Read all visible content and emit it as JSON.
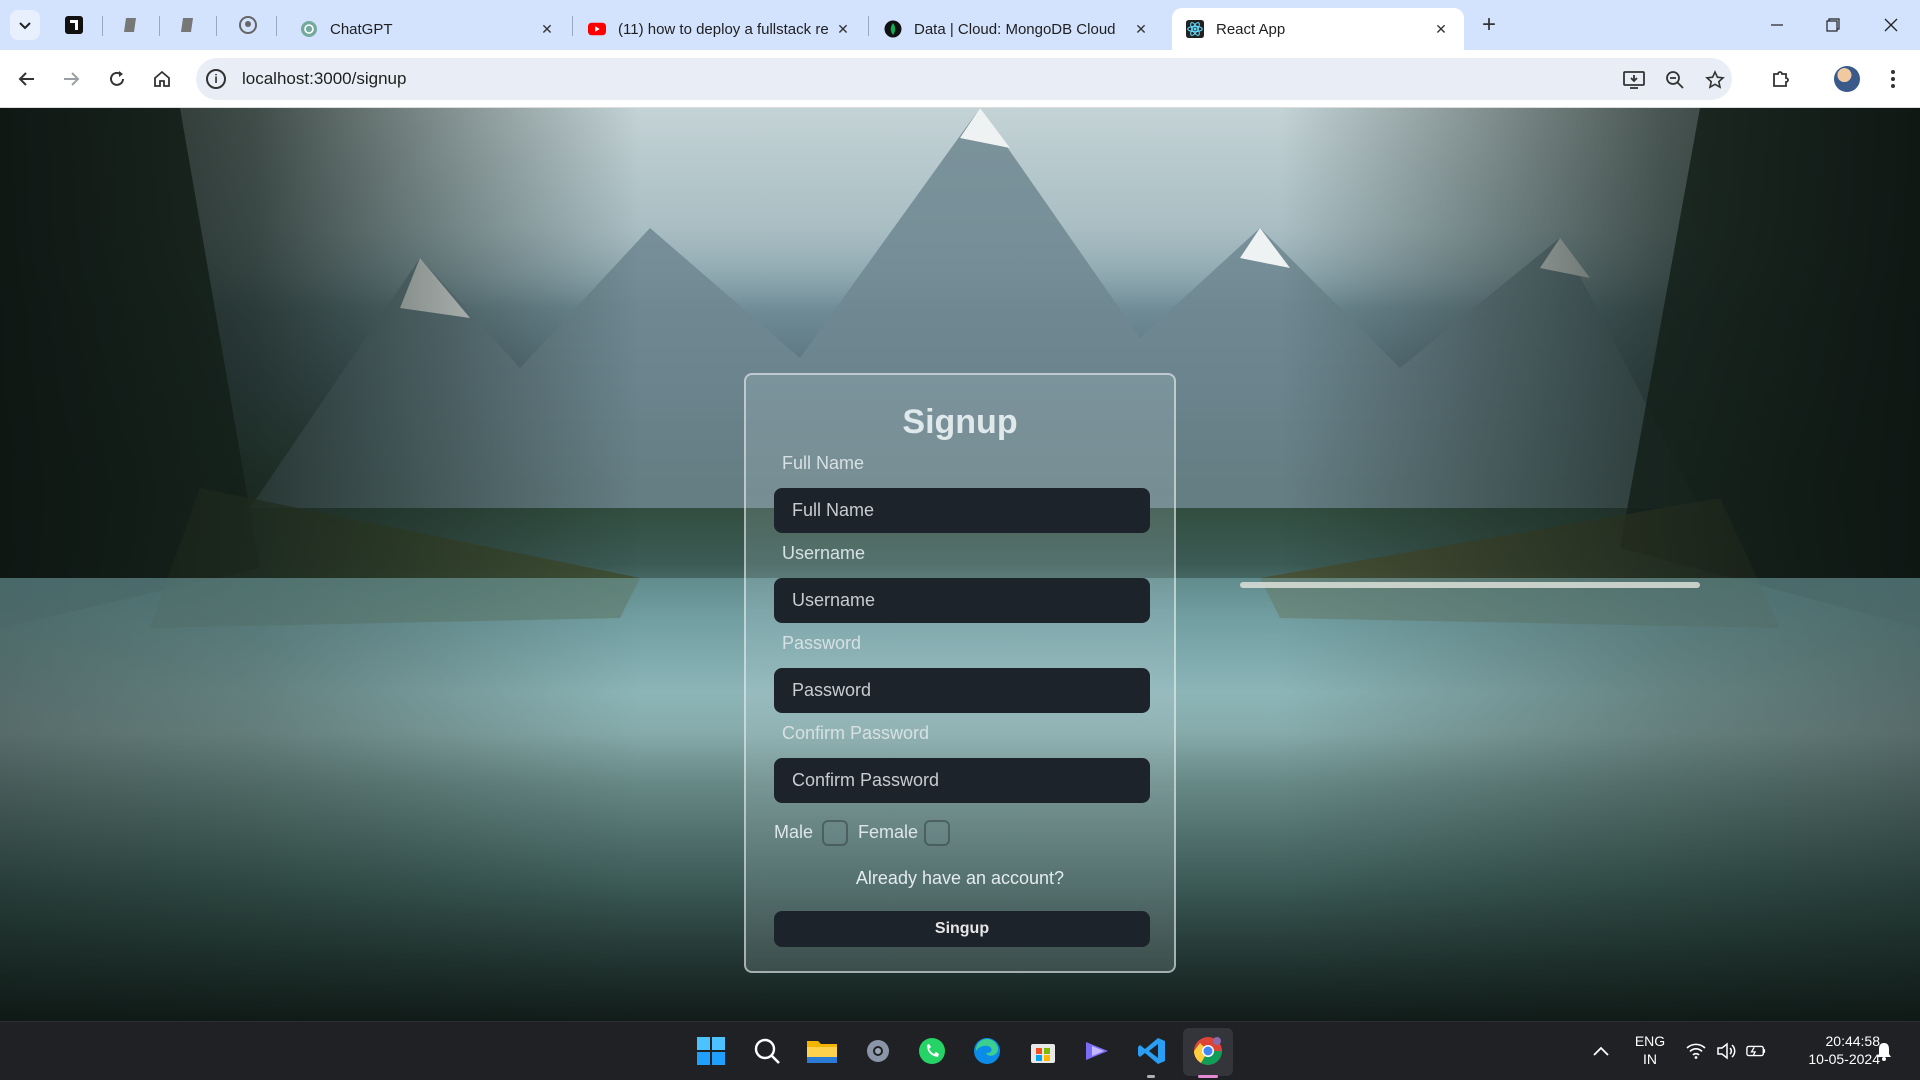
{
  "browser": {
    "tabs": [
      {
        "title": "ChatGPT",
        "icon": "chatgpt-icon"
      },
      {
        "title": "(11) how to deploy a fullstack re",
        "icon": "youtube-icon"
      },
      {
        "title": "Data | Cloud: MongoDB Cloud",
        "icon": "mongodb-icon"
      },
      {
        "title": "React App",
        "icon": "react-icon",
        "active": true
      }
    ],
    "pinned_tabs": [
      "notion-icon",
      "document-icon",
      "document-icon",
      "github-icon"
    ],
    "url": "localhost:3000/signup",
    "accent_color": "#d3e3fd"
  },
  "signup": {
    "title": "Signup",
    "full_name_label": "Full Name",
    "full_name_placeholder": "Full Name",
    "username_label": "Username",
    "username_placeholder": "Username",
    "password_label": "Password",
    "password_placeholder": "Password",
    "confirm_password_label": "Confirm Password",
    "confirm_password_placeholder": "Confirm Password",
    "gender_male": "Male",
    "gender_female": "Female",
    "login_link": "Already have an account?",
    "submit_label": "Singup"
  },
  "taskbar": {
    "apps": [
      "windows-start-icon",
      "search-icon",
      "file-explorer-icon",
      "settings-icon",
      "whatsapp-icon",
      "edge-icon",
      "microsoft-store-icon",
      "copilot-icon",
      "vscode-icon",
      "chrome-icon"
    ],
    "language": "ENG",
    "region": "IN",
    "time": "20:44:58",
    "date": "10-05-2024"
  }
}
